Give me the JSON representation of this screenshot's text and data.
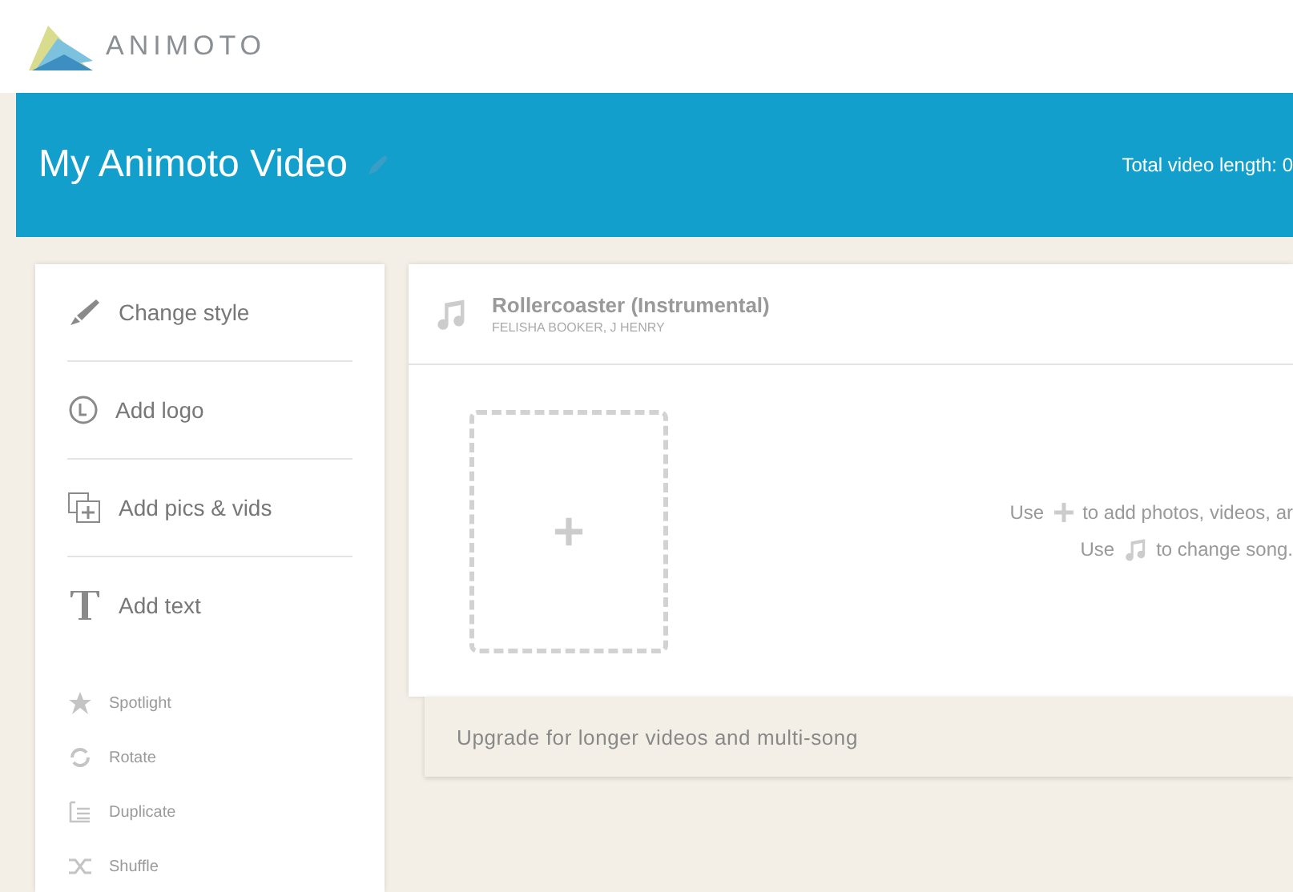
{
  "logo": {
    "text": "ANIMOTO"
  },
  "header": {
    "title": "My Animoto Video",
    "length": "Total video length: 0"
  },
  "sidebar": {
    "items": [
      {
        "label": "Change style",
        "disabled": false
      },
      {
        "label": "Add logo",
        "disabled": false
      },
      {
        "label": "Add pics & vids",
        "disabled": false
      },
      {
        "label": "Add text",
        "disabled": false
      },
      {
        "label": "Spotlight",
        "disabled": true
      },
      {
        "label": "Rotate",
        "disabled": true
      },
      {
        "label": "Duplicate",
        "disabled": true
      },
      {
        "label": "Shuffle",
        "disabled": true
      }
    ]
  },
  "song": {
    "title": "Rollercoaster (Instrumental)",
    "artist": "FELISHA BOOKER, J HENRY"
  },
  "hints": [
    {
      "before": "Use",
      "kind": "plus",
      "after": "to add photos, videos, ar"
    },
    {
      "before": "Use",
      "kind": "music",
      "after": "to change song."
    }
  ],
  "upgrade": "Upgrade for longer videos and multi-song"
}
